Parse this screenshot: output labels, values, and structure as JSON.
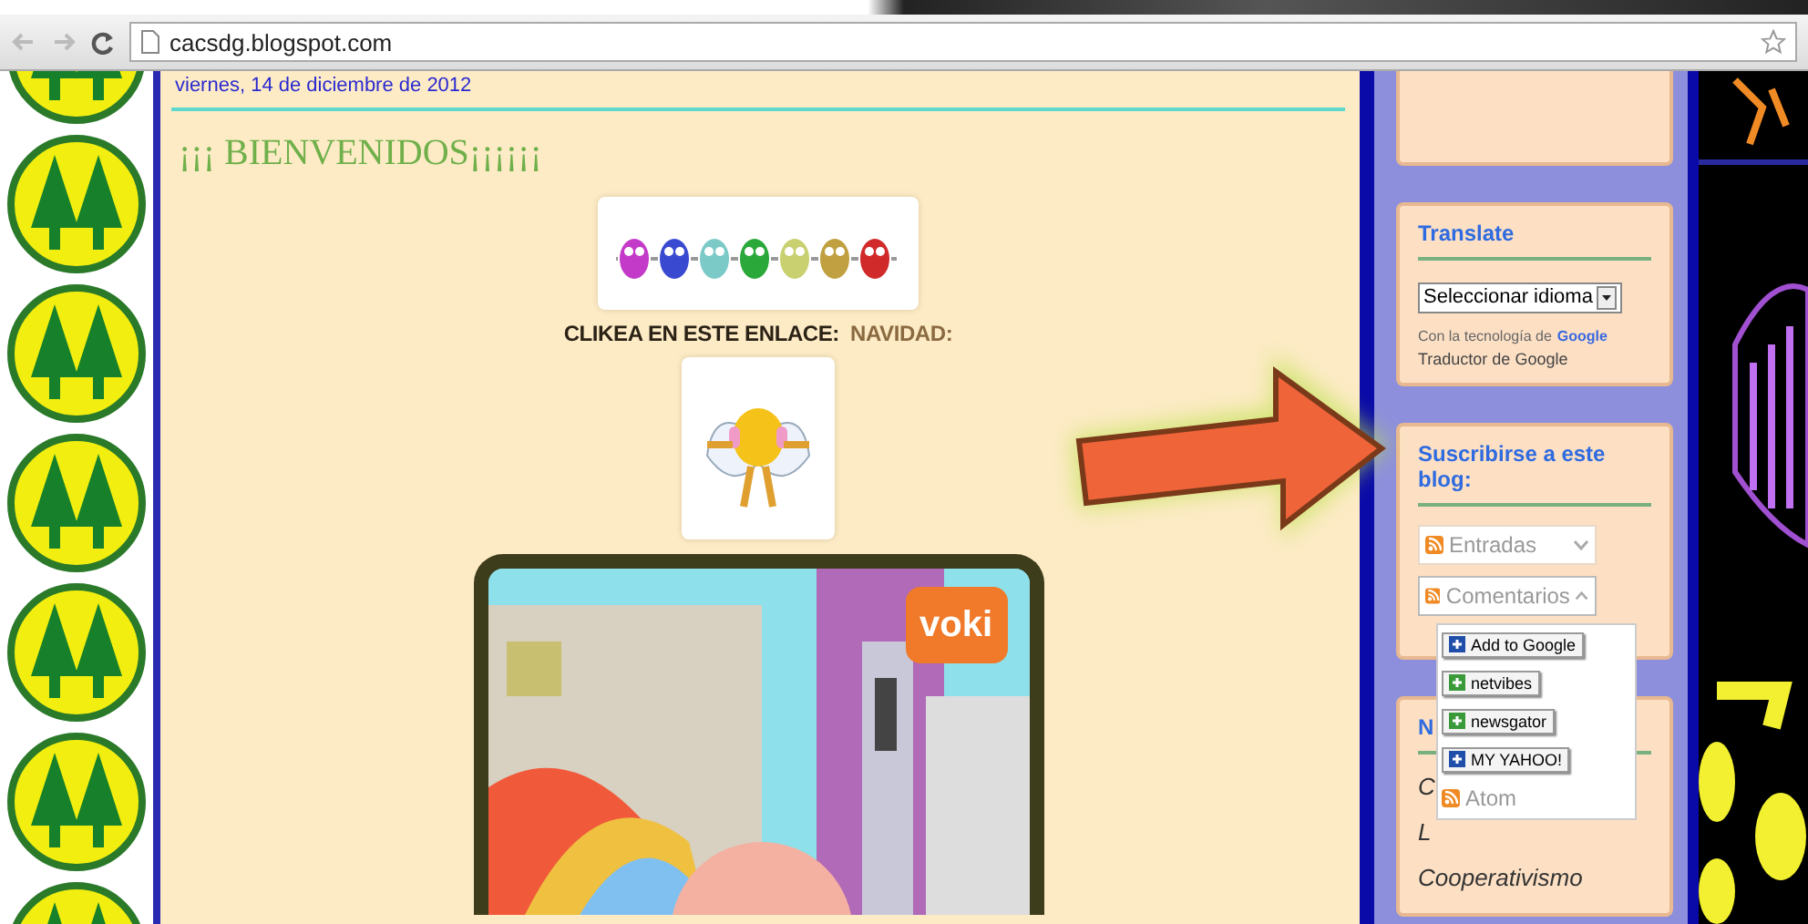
{
  "browser": {
    "url": "cacsdg.blogspot.com"
  },
  "post": {
    "date": "viernes, 14 de diciembre de 2012",
    "title": "¡¡¡ BIENVENIDOS¡¡¡¡¡¡",
    "link_label": "CLIKEA EN ESTE ENLACE:",
    "link": "NAVIDAD:",
    "voki_logo": "voki"
  },
  "sidebar": {
    "translate": {
      "title": "Translate",
      "select": "Seleccionar idioma",
      "powered_by": "Con la tecnología de",
      "google": "Google",
      "product": "Traductor de Google"
    },
    "subscribe": {
      "title": "Suscribirse a este blog:",
      "feeds": [
        {
          "label": "Entradas",
          "expanded": false
        },
        {
          "label": "Comentarios",
          "expanded": true
        }
      ],
      "menu": [
        {
          "kind": "reader",
          "label": "Add to Google",
          "color": "#1f4fa8"
        },
        {
          "kind": "reader",
          "label": "netvibes",
          "color": "#3a9a3a"
        },
        {
          "kind": "reader",
          "label": "newsgator",
          "color": "#3a9a3a"
        },
        {
          "kind": "reader",
          "label": "MY YAHOO!",
          "color": "#1f4fa8"
        },
        {
          "kind": "feed",
          "label": "Atom"
        }
      ]
    },
    "widget": {
      "title": "N",
      "items": [
        "C",
        "L",
        "Cooperativismo"
      ]
    }
  }
}
